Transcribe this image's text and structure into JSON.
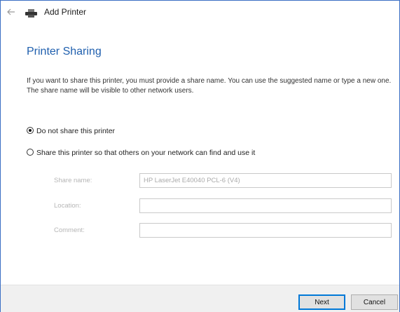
{
  "window": {
    "title": "Add Printer",
    "back_icon": "back-arrow-icon",
    "title_icon": "printer-icon",
    "border_color": "#3b6fc4"
  },
  "page": {
    "heading": "Printer Sharing",
    "description": "If you want to share this printer, you must provide a share name. You can use the suggested name or type a new one. The share name will be visible to other network users."
  },
  "options": {
    "no_share": {
      "label": "Do not share this printer",
      "selected": true
    },
    "share": {
      "label": "Share this printer so that others on your network can find and use it",
      "selected": false
    }
  },
  "fields": {
    "share_name": {
      "label": "Share name:",
      "value": "HP LaserJet E40040 PCL-6 (V4)",
      "enabled": false
    },
    "location": {
      "label": "Location:",
      "value": "",
      "enabled": false
    },
    "comment": {
      "label": "Comment:",
      "value": "",
      "enabled": false
    }
  },
  "footer": {
    "next_label": "Next",
    "cancel_label": "Cancel"
  },
  "colors": {
    "heading": "#1f5fae",
    "accent": "#0078d7"
  }
}
